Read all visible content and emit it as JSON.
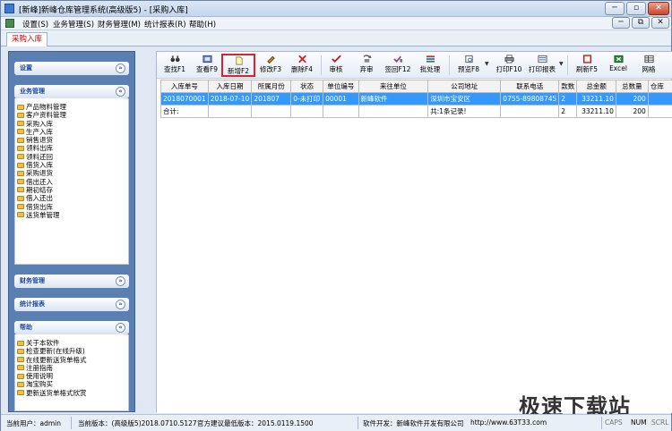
{
  "window": {
    "title": "[新峰]新峰仓库管理系统(高级版5) - [采购入库]",
    "min": "─",
    "restore": "▫",
    "close": "✕",
    "min2": "─",
    "restore2": "⧉",
    "close2": "✕"
  },
  "menu": [
    "设置(S)",
    "业务管理(S)",
    "财务管理(M)",
    "统计报表(R)",
    "帮助(H)"
  ],
  "tab": "采购入库",
  "sidebar": {
    "sections": [
      {
        "title": "设置",
        "chevron": "»"
      },
      {
        "title": "业务管理",
        "chevron": "«",
        "items": [
          "产品物料管理",
          "客户资料管理",
          "采购入库",
          "生产入库",
          "销售退货",
          "领料出库",
          "领料还回",
          "借货入库",
          "采购退货",
          "借出还入",
          "期初结存",
          "借入还出",
          "借货出库",
          "送货单管理"
        ]
      },
      {
        "title": "财务管理",
        "chevron": "»"
      },
      {
        "title": "统计报表",
        "chevron": "»"
      },
      {
        "title": "帮助",
        "chevron": "«",
        "items": [
          "关于本软件",
          "检查更新(在线升级)",
          "在线更新送货单格式",
          "注册指南",
          "使用说明",
          "淘宝购买",
          "更新送货单格式欣赏"
        ]
      }
    ]
  },
  "toolbar": {
    "buttons": [
      {
        "label": "查找F1",
        "icon": "binoculars-icon"
      },
      {
        "label": "查看F9",
        "icon": "view-icon"
      },
      {
        "label": "新增F2",
        "icon": "new-document-icon",
        "selected": true
      },
      {
        "label": "修改F3",
        "icon": "edit-icon"
      },
      {
        "label": "删除F4",
        "icon": "delete-icon"
      },
      {
        "label": "审核",
        "icon": "check-icon"
      },
      {
        "label": "弃审",
        "icon": "unapprove-icon"
      },
      {
        "label": "签回F12",
        "icon": "signback-icon"
      },
      {
        "label": "批处理",
        "icon": "batch-icon"
      },
      {
        "label": "预览F8",
        "icon": "preview-icon"
      },
      {
        "label": "打印F10",
        "icon": "printer-icon"
      },
      {
        "label": "打印报表",
        "icon": "print-report-icon"
      },
      {
        "label": "刷新F5",
        "icon": "refresh-icon"
      },
      {
        "label": "Excel",
        "icon": "excel-icon"
      },
      {
        "label": "网格",
        "icon": "grid-icon"
      }
    ],
    "dropdown_arrow": "▼"
  },
  "table": {
    "columns": [
      "入库单号",
      "入库日期",
      "所属月份",
      "状态",
      "单位编号",
      "来往单位",
      "公司地址",
      "联系电话",
      "款数",
      "总金额",
      "总数量",
      "仓库"
    ],
    "rows": [
      [
        "2018070001",
        "2018-07-10",
        "201807",
        "0-未打印",
        "00001",
        "新峰软件",
        "深圳市宝安区",
        "0755-89808745",
        "2",
        "33211.10",
        "200",
        ""
      ]
    ],
    "total_row": [
      "合计:",
      "",
      "",
      "",
      "",
      "",
      "共:1条记录!",
      "",
      "2",
      "33211.10",
      "200",
      ""
    ]
  },
  "status": {
    "user": "当前用户：admin",
    "version": "当前版本：(高级版5)2018.0710.5127",
    "recommended": "官方建议最低版本：2015.0119.1500",
    "developer": "软件开发：新峰软件开发有限公司",
    "url": "http://www.63T33.com",
    "caps": "CAPS",
    "num": "NUM",
    "scrl": "SCRL"
  },
  "watermark": "极速下载站",
  "colors": {
    "accent": "#3399ff",
    "sidebar_bg": "#5a7fb3",
    "highlight_border": "#d9232d",
    "tab_text": "#c40000"
  }
}
